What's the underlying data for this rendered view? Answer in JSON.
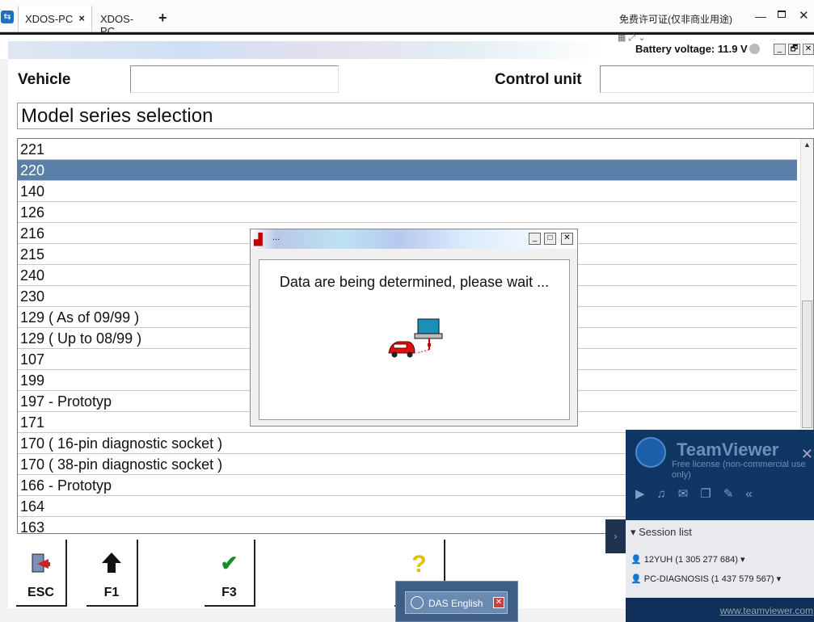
{
  "teamviewer_tabs": [
    {
      "label": "XDOS-PC",
      "close": "×"
    },
    {
      "label": "XDOS-PC"
    }
  ],
  "add_tab_glyph": "+",
  "license_text": "免费许可证(仅非商业用途)",
  "window_controls": {
    "minimize": "—",
    "close": "✕"
  },
  "battery": {
    "text": "Battery voltage: 11.9 V"
  },
  "caption_buttons": {
    "minimize": "_",
    "restore": "🗗",
    "close": "✕"
  },
  "header": {
    "vehicle_label": "Vehicle",
    "vehicle_value": "",
    "control_unit_label": "Control unit",
    "control_unit_value": ""
  },
  "section_title": "Model series selection",
  "model_series": [
    {
      "label": "221"
    },
    {
      "label": "220",
      "selected": true
    },
    {
      "label": "140"
    },
    {
      "label": "126"
    },
    {
      "label": "216"
    },
    {
      "label": "215"
    },
    {
      "label": "240"
    },
    {
      "label": "230"
    },
    {
      "label": "129 ( As of 09/99 )"
    },
    {
      "label": "129 ( Up to 08/99 )"
    },
    {
      "label": "107"
    },
    {
      "label": "199"
    },
    {
      "label": "197 - Prototyp"
    },
    {
      "label": "171"
    },
    {
      "label": "170 ( 16-pin diagnostic socket )"
    },
    {
      "label": "170 ( 38-pin diagnostic socket )"
    },
    {
      "label": "166 - Prototyp"
    },
    {
      "label": "164"
    },
    {
      "label": "163"
    }
  ],
  "function_keys": [
    {
      "label": "ESC",
      "icon": "exit-icon"
    },
    {
      "label": "F1",
      "icon": "up-arrow-icon"
    },
    {
      "label": "F3",
      "icon": "checkmark-icon"
    },
    {
      "label": "",
      "icon": "help-icon"
    }
  ],
  "dialog": {
    "title": "...",
    "message": "Data are being determined, please wait ..."
  },
  "teamviewer_panel": {
    "brand": "TeamViewer",
    "license": "Free license (non-commercial use only)",
    "session_list_label": "Session list",
    "sessions": [
      "12YUH (1 305 277 684)",
      "PC-DIAGNOSIS (1 437 579 567)"
    ],
    "link": "www.teamviewer.com"
  },
  "taskbar_popup": {
    "label": "DAS English"
  },
  "colors": {
    "selection": "#5a7fa8",
    "teamviewer_blue": "#103664"
  }
}
